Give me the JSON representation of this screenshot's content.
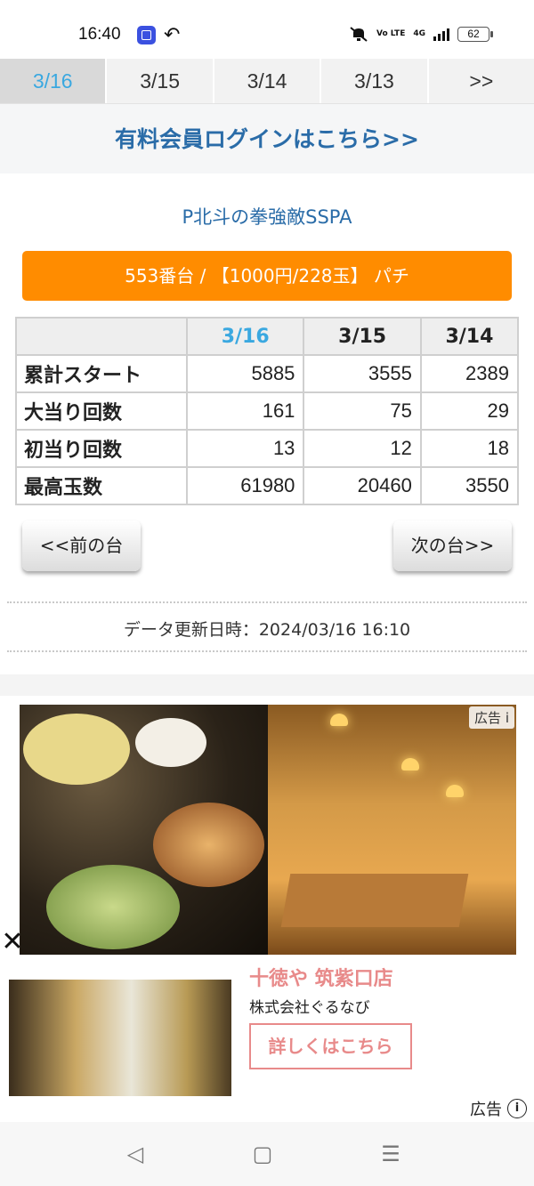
{
  "status_bar": {
    "time": "16:40",
    "battery": "62",
    "network": "4G",
    "volte": "Vo LTE"
  },
  "date_tabs": [
    {
      "label": "3/16",
      "active": true
    },
    {
      "label": "3/15",
      "active": false
    },
    {
      "label": "3/14",
      "active": false
    },
    {
      "label": "3/13",
      "active": false
    },
    {
      "label": ">>",
      "active": false
    }
  ],
  "member_login": {
    "label": "有料会員ログインはこちら>>"
  },
  "machine": {
    "name": "P北斗の拳強敵SSPA",
    "banner": "553番台 / 【1000円/228玉】 パチ"
  },
  "stats_table": {
    "columns": [
      "",
      "3/16",
      "3/15",
      "3/14"
    ],
    "rows": [
      {
        "label": "累計スタート",
        "values": [
          "5885",
          "3555",
          "2389"
        ]
      },
      {
        "label": "大当り回数",
        "values": [
          "161",
          "75",
          "29"
        ]
      },
      {
        "label": "初当り回数",
        "values": [
          "13",
          "12",
          "18"
        ]
      },
      {
        "label": "最高玉数",
        "values": [
          "61980",
          "20460",
          "3550"
        ]
      }
    ]
  },
  "nav": {
    "prev": "<<前の台",
    "next": "次の台>>"
  },
  "update_text": "データ更新日時：2024/03/16 16:10",
  "ad": {
    "badge": "広告",
    "close": "✕",
    "title": "十徳や 筑紫口店",
    "company": "株式会社ぐるなび",
    "cta": "詳しくはこちら",
    "label": "広告",
    "info_icon": "i"
  },
  "colors": {
    "accent_blue": "#2a6ca8",
    "active_tab_text": "#3aa8e0",
    "banner_orange": "#ff8c00",
    "ad_pink": "#e88a8a"
  },
  "icons": {
    "back": "back-arrow-icon",
    "home": "home-icon",
    "menu": "menu-icon"
  }
}
